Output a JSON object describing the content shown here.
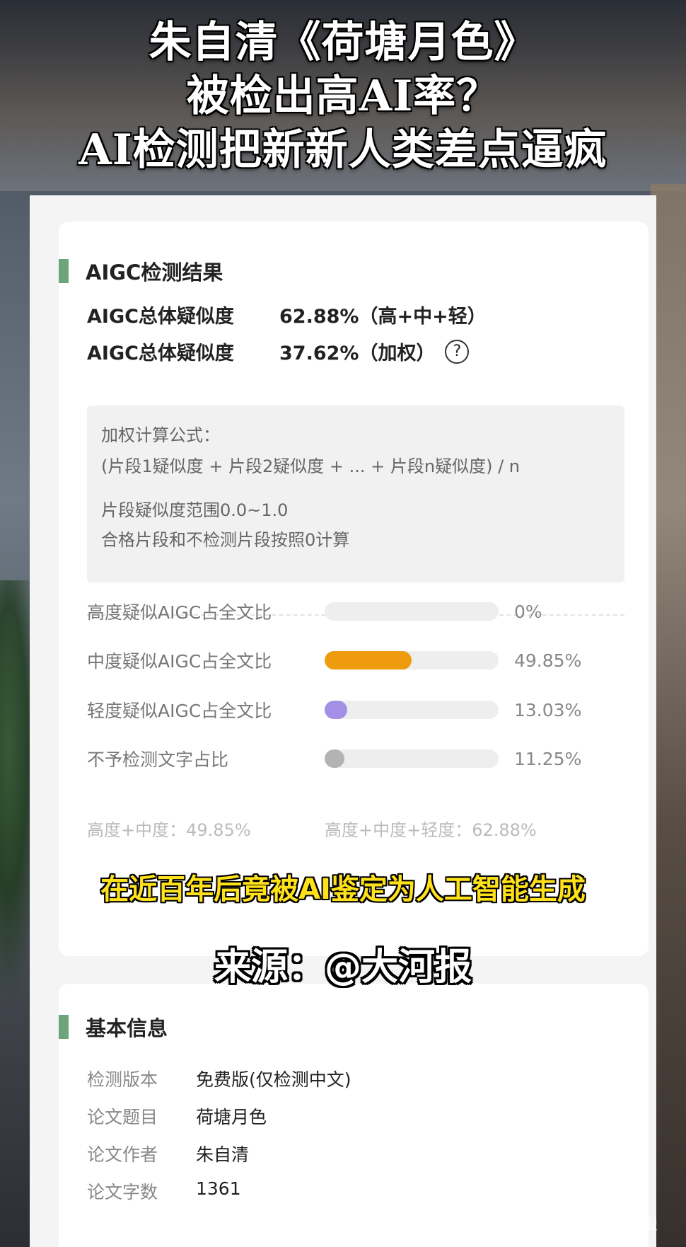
{
  "headline": {
    "line1": "朱自清《荷塘月色》",
    "line2": "被检出高AI率？",
    "line3": "AI检测把新新人类差点逼疯"
  },
  "result": {
    "title": "AIGC检测结果",
    "stats": [
      {
        "label": "AIGC总体疑似度",
        "value": "62.88%（高+中+轻）"
      },
      {
        "label": "AIGC总体疑似度",
        "value": "37.62%（加权）"
      }
    ],
    "help_glyph": "?",
    "formula": {
      "line1": "加权计算公式：",
      "line2": "(片段1疑似度 + 片段2疑似度 + ... + 片段n疑似度) / n",
      "line3": "片段疑似度范围0.0~1.0",
      "line4": "合格片段和不检测片段按照0计算"
    },
    "bars": [
      {
        "label": "高度疑似AIGC占全文比",
        "value": "0%",
        "percent": 0,
        "color": "#e0e0e0"
      },
      {
        "label": "中度疑似AIGC占全文比",
        "value": "49.85%",
        "percent": 49.85,
        "color": "#ef9b0f"
      },
      {
        "label": "轻度疑似AIGC占全文比",
        "value": "13.03%",
        "percent": 13.03,
        "color": "#a48fe6"
      },
      {
        "label": "不予检测文字占比",
        "value": "11.25%",
        "percent": 11.25,
        "color": "#b3b3b3"
      }
    ],
    "cut_left": "高度+中度：49.85%",
    "cut_right": "高度+中度+轻度：62.88%"
  },
  "subtitles": {
    "yellow": "在近百年后竟被AI鉴定为人工智能生成",
    "white": "来源：@大河报"
  },
  "basic": {
    "title": "基本信息",
    "rows": [
      {
        "key": "检测版本",
        "value": "免费版(仅检测中文)"
      },
      {
        "key": "论文题目",
        "value": "荷塘月色"
      },
      {
        "key": "论文作者",
        "value": "朱自清"
      },
      {
        "key": "论文字数",
        "value": "1361"
      }
    ]
  },
  "watermark": "大河报"
}
